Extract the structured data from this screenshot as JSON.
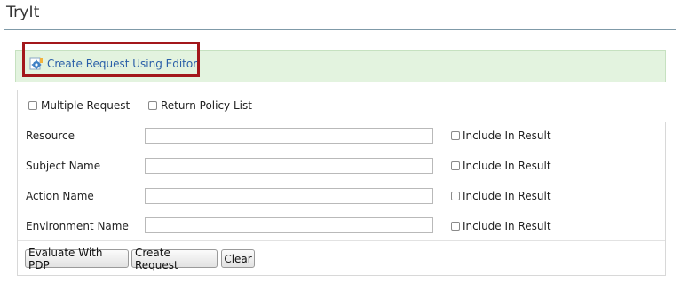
{
  "page": {
    "title": "TryIt"
  },
  "editor_link": {
    "label": "Create Request Using Editor",
    "icon": "gear-edit-icon"
  },
  "options": {
    "multiple_request": {
      "label": "Multiple Request",
      "checked": false
    },
    "return_policy_list": {
      "label": "Return Policy List",
      "checked": false
    }
  },
  "rows": [
    {
      "label": "Resource",
      "value": "",
      "include_label": "Include In Result",
      "include_checked": false
    },
    {
      "label": "Subject Name",
      "value": "",
      "include_label": "Include In Result",
      "include_checked": false
    },
    {
      "label": "Action Name",
      "value": "",
      "include_label": "Include In Result",
      "include_checked": false
    },
    {
      "label": "Environment Name",
      "value": "",
      "include_label": "Include In Result",
      "include_checked": false
    }
  ],
  "buttons": {
    "evaluate": "Evaluate With PDP",
    "create": "Create Request",
    "clear": "Clear"
  },
  "colors": {
    "highlight": "#a3171b",
    "link": "#2a5fa8",
    "green_bar": "#e3f3df"
  }
}
